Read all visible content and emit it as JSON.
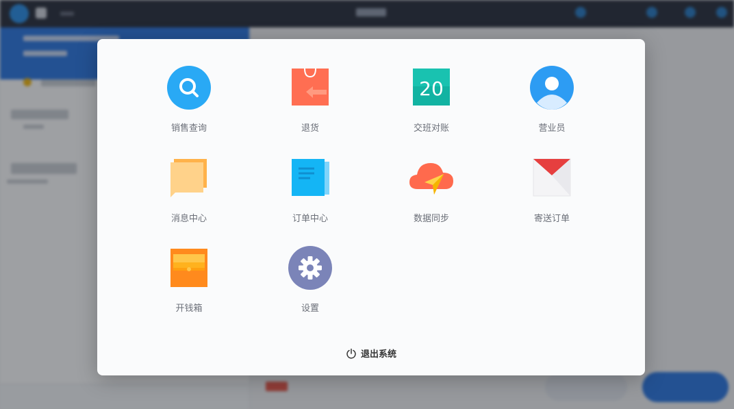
{
  "menu": {
    "items": [
      {
        "id": "sales-query",
        "label": "销售查询",
        "icon": "search-icon",
        "color": "#29a9f5"
      },
      {
        "id": "return",
        "label": "退货",
        "icon": "shopping-bag-return-icon",
        "color": "#ff6e52"
      },
      {
        "id": "shift-handover",
        "label": "交班对账",
        "icon": "calendar-icon",
        "color": "#12b3a2",
        "calendar_day": "20"
      },
      {
        "id": "salesperson",
        "label": "营业员",
        "icon": "person-icon",
        "color": "#2d9cf3"
      },
      {
        "id": "message-center",
        "label": "消息中心",
        "icon": "message-icon",
        "color": "#ffc96b"
      },
      {
        "id": "order-center",
        "label": "订单中心",
        "icon": "document-icon",
        "color": "#14b5f5"
      },
      {
        "id": "data-sync",
        "label": "数据同步",
        "icon": "cloud-send-icon",
        "color": "#ff6a4d"
      },
      {
        "id": "delivery-order",
        "label": "寄送订单",
        "icon": "envelope-icon",
        "color": "#e63f3f"
      },
      {
        "id": "open-cash-drawer",
        "label": "开钱箱",
        "icon": "cash-drawer-icon",
        "color": "#ff8a1d"
      },
      {
        "id": "settings",
        "label": "设置",
        "icon": "gear-icon",
        "color": "#7b84b8"
      }
    ],
    "logout": {
      "label": "退出系统",
      "icon": "power-icon"
    }
  }
}
